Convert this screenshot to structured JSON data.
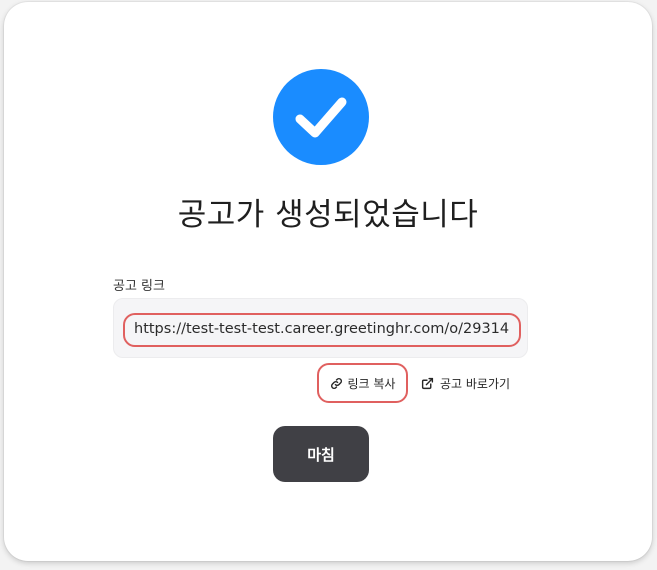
{
  "dialog": {
    "title": "공고가 생성되었습니다",
    "link_label": "공고 링크",
    "link_url": "https://test-test-test.career.greetinghr.com/o/29314",
    "copy_label": "링크 복사",
    "go_label": "공고 바로가기",
    "done_label": "마침"
  },
  "icons": {
    "status": "check-circle-icon",
    "copy": "link-icon",
    "go": "external-link-icon"
  },
  "colors": {
    "accent": "#1a8cff",
    "highlight": "#e0605f",
    "primary_button": "#404045"
  }
}
